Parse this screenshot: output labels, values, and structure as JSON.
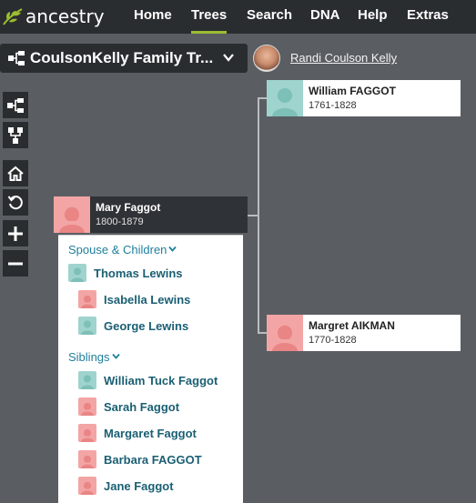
{
  "nav": {
    "logo_text": "ancestry",
    "items": [
      {
        "label": "Home",
        "active": false
      },
      {
        "label": "Trees",
        "active": true
      },
      {
        "label": "Search",
        "active": false
      },
      {
        "label": "DNA",
        "active": false
      },
      {
        "label": "Help",
        "active": false
      },
      {
        "label": "Extras",
        "active": false
      }
    ],
    "accent_color": "#9cbe30"
  },
  "tree_selector": {
    "title": "CoulsonKelly Family Tr...",
    "icon": "tree-view-icon"
  },
  "user": {
    "name": "Randi Coulson Kelly",
    "avatar": "user-photo"
  },
  "tools": [
    "pedigree-view-icon",
    "family-view-icon",
    "home-icon",
    "refresh-icon",
    "zoom-in-icon",
    "zoom-out-icon"
  ],
  "focus_person": {
    "name": "Mary Faggot",
    "dates": "1800-1879",
    "gender": "female"
  },
  "parents": [
    {
      "name": "William FAGGOT",
      "dates": "1761-1828",
      "gender": "male"
    },
    {
      "name": "Margret AIKMAN",
      "dates": "1770-1828",
      "gender": "female"
    }
  ],
  "family_panel": {
    "spouse_heading": "Spouse & Children",
    "spouse": {
      "name": "Thomas Lewins",
      "gender": "male"
    },
    "children": [
      {
        "name": "Isabella Lewins",
        "gender": "female"
      },
      {
        "name": "George Lewins",
        "gender": "male"
      }
    ],
    "siblings_heading": "Siblings",
    "siblings": [
      {
        "name": "William Tuck Faggot",
        "gender": "male"
      },
      {
        "name": "Sarah Faggot",
        "gender": "female"
      },
      {
        "name": "Margaret Faggot",
        "gender": "female"
      },
      {
        "name": "Barbara FAGGOT",
        "gender": "female"
      },
      {
        "name": "Jane Faggot",
        "gender": "female"
      }
    ]
  },
  "colors": {
    "canvas": "#5a5e63",
    "chrome": "#2a2d30",
    "male": "#9fd3cd",
    "female": "#f3a5a5",
    "link": "#1f7f9c"
  }
}
